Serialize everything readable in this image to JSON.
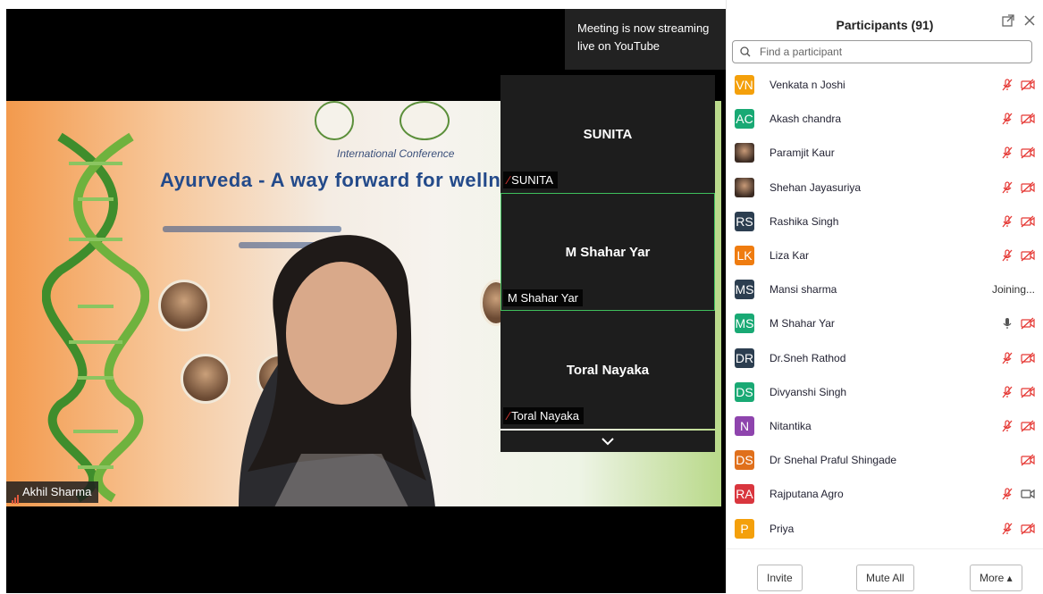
{
  "toast": {
    "text_line1": "Meeting is now streaming",
    "text_line2": "live on YouTube"
  },
  "banner": {
    "title": "Ayurveda - A way forward for wellness",
    "subtitle": "International Conference"
  },
  "main_video": {
    "speaker_name": "Akhil Sharma"
  },
  "thumbnails": [
    {
      "center_name": "SUNITA",
      "label": "SUNITA",
      "muted": true,
      "active": false
    },
    {
      "center_name": "M Shahar Yar",
      "label": "M Shahar Yar",
      "muted": false,
      "active": true
    },
    {
      "center_name": "Toral Nayaka",
      "label": "Toral Nayaka",
      "muted": true,
      "active": false
    }
  ],
  "panel": {
    "title": "Participants (91)",
    "search_placeholder": "Find a participant",
    "participants": [
      {
        "initials": "VN",
        "name": "Venkata n Joshi",
        "color": "#f4a00b",
        "status": "muted-video-off"
      },
      {
        "initials": "AC",
        "name": "Akash chandra",
        "color": "#19a974",
        "status": "muted-video-off"
      },
      {
        "initials": "",
        "name": "Paramjit Kaur",
        "color": "photo",
        "status": "muted-video-off"
      },
      {
        "initials": "",
        "name": "Shehan Jayasuriya",
        "color": "photo",
        "status": "muted-video-off"
      },
      {
        "initials": "RS",
        "name": "Rashika Singh",
        "color": "#2c3e50",
        "status": "muted-video-off"
      },
      {
        "initials": "LK",
        "name": "Liza Kar",
        "color": "#ef7c10",
        "status": "muted-video-off"
      },
      {
        "initials": "MS",
        "name": "Mansi sharma",
        "color": "#2c3e50",
        "status": "joining",
        "status_text": "Joining..."
      },
      {
        "initials": "MS",
        "name": "M Shahar Yar",
        "color": "#19a974",
        "status": "mic-video-off"
      },
      {
        "initials": "DR",
        "name": "Dr.Sneh Rathod",
        "color": "#2c3e50",
        "status": "muted-video-off"
      },
      {
        "initials": "DS",
        "name": "Divyanshi Singh",
        "color": "#19a974",
        "status": "muted-video-off"
      },
      {
        "initials": "N",
        "name": "Nitantika",
        "color": "#8e44ad",
        "status": "muted-video-off"
      },
      {
        "initials": "DS",
        "name": "Dr Snehal Praful Shingade",
        "color": "#e0701c",
        "status": "video-off"
      },
      {
        "initials": "RA",
        "name": "Rajputana Agro",
        "color": "#d9363e",
        "status": "muted-video-on"
      },
      {
        "initials": "P",
        "name": "Priya",
        "color": "#f4a00b",
        "status": "muted-video-off"
      }
    ],
    "footer": {
      "invite": "Invite",
      "mute_all": "Mute All",
      "more": "More ▴"
    }
  }
}
